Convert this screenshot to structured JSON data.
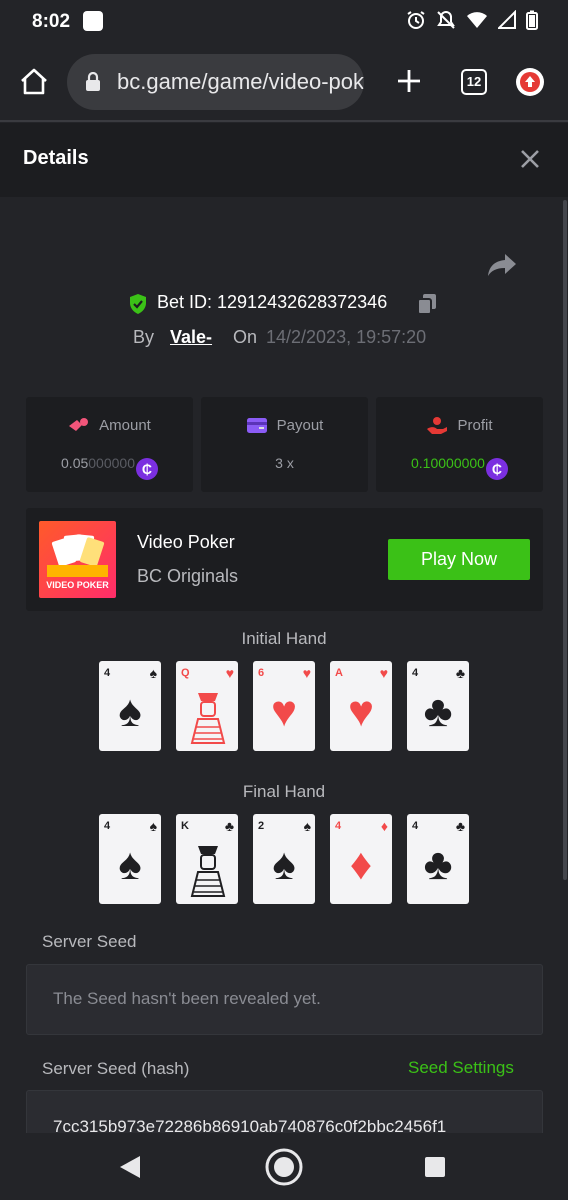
{
  "status": {
    "time": "8:02"
  },
  "browser": {
    "url": "bc.game/game/video-poker",
    "tab_count": "12"
  },
  "details": {
    "title": "Details"
  },
  "bet": {
    "label": "Bet ID: 12912432628372346",
    "by_label": "By",
    "user": "Vale-",
    "on_label": "On",
    "date": "14/2/2023, 19:57:20"
  },
  "stats": {
    "amount": {
      "label": "Amount",
      "value_main": "0.05",
      "value_dim": "000000"
    },
    "payout": {
      "label": "Payout",
      "value": "3 x"
    },
    "profit": {
      "label": "Profit",
      "value_main": "0.1",
      "value_dim": "0000000"
    },
    "coin_symbol": "₵"
  },
  "game": {
    "name": "Video Poker",
    "provider": "BC Originals",
    "play_label": "Play Now",
    "thumb_text": "VIDEO POKER"
  },
  "hands": {
    "initial_label": "Initial Hand",
    "final_label": "Final Hand",
    "initial": [
      {
        "rank": "4",
        "suit": "♠",
        "color": "black"
      },
      {
        "rank": "Q",
        "suit": "♥",
        "color": "red"
      },
      {
        "rank": "6",
        "suit": "♥",
        "color": "red"
      },
      {
        "rank": "A",
        "suit": "♥",
        "color": "red"
      },
      {
        "rank": "4",
        "suit": "♣",
        "color": "black"
      }
    ],
    "final": [
      {
        "rank": "4",
        "suit": "♠",
        "color": "black"
      },
      {
        "rank": "K",
        "suit": "♣",
        "color": "black"
      },
      {
        "rank": "2",
        "suit": "♠",
        "color": "black"
      },
      {
        "rank": "4",
        "suit": "♦",
        "color": "red"
      },
      {
        "rank": "4",
        "suit": "♣",
        "color": "black"
      }
    ]
  },
  "server_seed": {
    "label": "Server Seed",
    "value": "The Seed hasn't been revealed yet.",
    "hash_label": "Server Seed (hash)",
    "settings_label": "Seed Settings",
    "hash_value": "7cc315b973e72286b86910ab740876c0f2bbc2456f1"
  },
  "colors": {
    "accent": "#3bc117",
    "coin": "#7b2fe0",
    "panel": "#1c1d20",
    "background": "#232428"
  }
}
